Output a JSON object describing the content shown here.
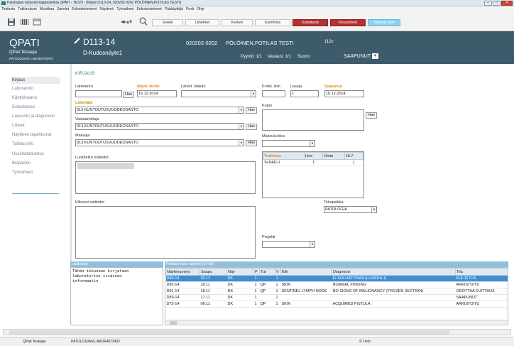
{
  "window": {
    "title": "Patologian laboratoriojärjestelmä QPATI - TESTI - [Näyte D113-14, 020202-0202 PÖLÖINEN,POTILAS TESTI]"
  },
  "menu": [
    "Tiedosto",
    "Tutkimukset",
    "Muokkaa",
    "Sanelut",
    "Erikoistoiminnot",
    "Näyttenö",
    "Työvaiheet",
    "Erikoistoiminnot",
    "Pääkäyttäjä",
    "Posti",
    "Ohje"
  ],
  "toolbar": {
    "buttons": [
      "Selaile",
      "Lähetteet",
      "Kesken",
      "Kuormitus",
      "Kuitattavat",
      "Konsultointi",
      "Kirjaudu ulos"
    ],
    "colors": {
      "red": "#b3312e",
      "lightblue": "#8fd0ea"
    }
  },
  "header": {
    "app_name": "QPATI",
    "user": "QPati Testaaja",
    "lab": "PATOLOGIAN LABORATORIO",
    "sample_id": "D113-14",
    "sample_type": "D-Kudosnäyte1",
    "patient_id": "020202-0202",
    "patient_name": "PÖLÖINEN,POTILAS TESTI",
    "room": "112v",
    "pyynto": "Pyyntö: 1/1",
    "vastaus": "Vastaus: 1/1",
    "language": "Suomi",
    "state": "SAAPUNUT",
    "bg": "#3e5b6c"
  },
  "nav": [
    "Kirjaus",
    "Laboratorio",
    "Käyttöinpano",
    "Esitarkastus",
    "Lausunto ja diagnoosit",
    "Liitteet",
    "Näytteen tapahtumat",
    "Talletusinfo",
    "Uusintatarkastus",
    "Biopankki",
    "Työvaiheet"
  ],
  "form": {
    "section": "KIRJAUS",
    "lahetenro_label": "Lähetenro",
    "lahetenro": "",
    "hae": "Hae",
    "nayte_otettu_label": "Näyte otettu",
    "nayte_otettu": "16.12.2014",
    "lahett_laakari_label": "Lähett. lääkäri",
    "lahett_laakari": "",
    "purkk_lkm_label": "Purkk. lkm",
    "purkk_lkm": "",
    "laseja_label": "Laseja",
    "laseja": "1",
    "saapunut_label": "Saapunut",
    "saapunut": "16.12.2014",
    "lahettaja_label": "Lähettäjä",
    "lahettaja": "913 KUNTOUTUSVUODEOSASTO",
    "vastaanottaja_label": "Vastaanottaja",
    "vastaanottaja": "913 KUNTOUTUSVUODEOSASTO",
    "maksaja_label": "Maksaja",
    "maksaja": "913 KUNTOUTUSVUODEOSASTO",
    "kopio_label": "Kopio",
    "maksuluokka_label": "Maksuluokka",
    "maksuluokka": "",
    "luokitellut_label": "Luokitellut esitiedot",
    "kliiniset_label": "Kliiniset esitiedot",
    "tekopaikka_label": "Tekopaikka",
    "tekopaikka": "PATOLOGIA",
    "projekti_label": "Projekti",
    "projekti": "",
    "orange": "#e08a1a"
  },
  "tutkimus": {
    "headers": [
      "Tutkimus",
      "Lkm",
      "Hinta",
      "HL7"
    ],
    "rows": [
      [
        "Ts-PAD-1",
        "1",
        "",
        "L"
      ]
    ]
  },
  "lisatietoja": {
    "label": "Lisätietoja",
    "text_line1": "Tähän ikkunaan kirjataan",
    "text_line2": "laboratorion sisäinen",
    "text_line3": "informaatio"
  },
  "others": {
    "label": "Potilaan muut näytteet (14 kpl)",
    "headers": [
      "Näytenumero",
      "Saapu",
      "Näy",
      "P",
      "Tut",
      "V",
      "Elin",
      "Diagnoosi",
      "Tila"
    ],
    "rows": [
      [
        "D93-14",
        "20.11",
        "DK",
        "1",
        "",
        "1",
        "",
        "EI SOLUATYPIAA (LUOKKA 1)",
        "KULJETUS"
      ],
      [
        "D92-14",
        "18.11",
        "DK",
        "1",
        "QP",
        "1",
        "SKIN",
        "NORMAL FINDING",
        "ARKISTOITU"
      ],
      [
        "D91-14",
        "18.11",
        "DK",
        "1",
        "QP",
        "1",
        "SENTINEL LYMPH NODE",
        "NO SIGNS OF MALIGNANCY (FROZEN SECTION)",
        "ODOTTAA KUITTAUS"
      ],
      [
        "D89-14",
        "17.11",
        "DK",
        "1",
        "",
        "1",
        "",
        "",
        "SAAPUNUT"
      ],
      [
        "D75-14",
        "06.11",
        "DK",
        "1",
        "QP",
        "1",
        "SKIN",
        "ACQUIRED FISTULA",
        "ARKISTOITU"
      ]
    ]
  },
  "status": {
    "user": "QPati Testaaja",
    "lab": "PATOLOGIAN LABORATORIO",
    "copyright": "© Tieto"
  }
}
